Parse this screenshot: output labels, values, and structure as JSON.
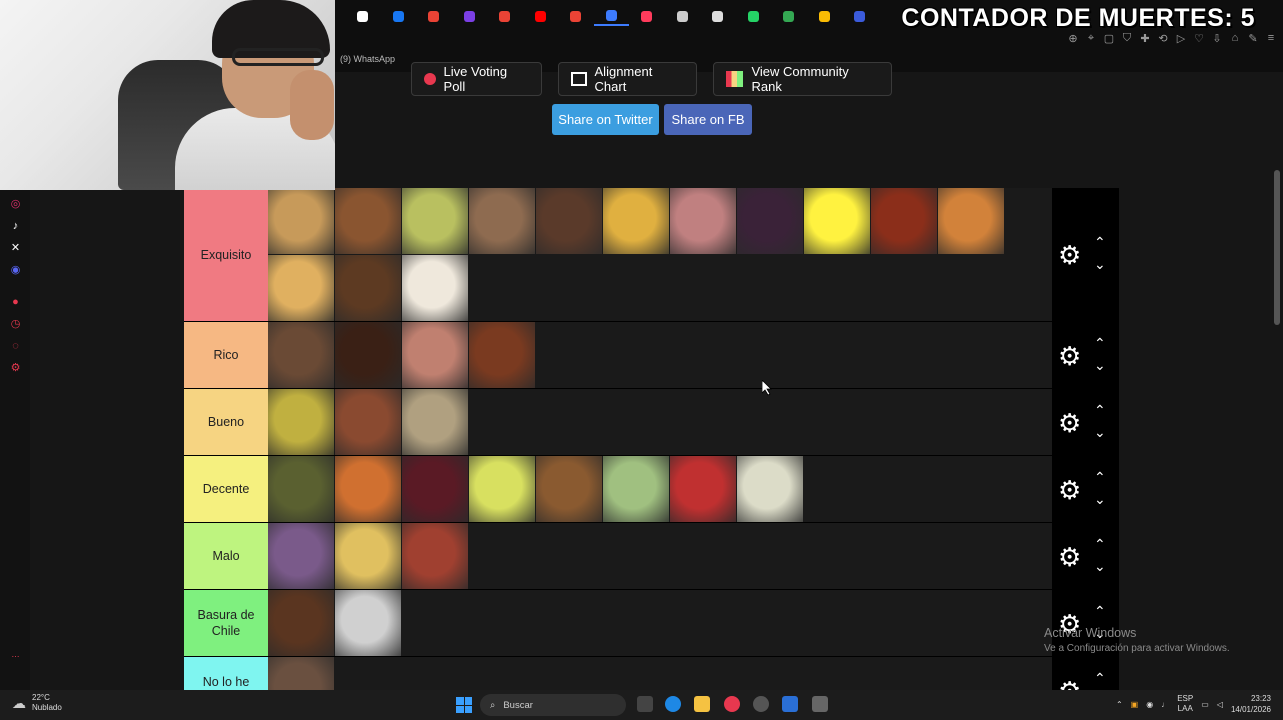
{
  "browser": {
    "tab_title": "(9) WhatsApp",
    "tab_icons": [
      "tiktok-icon",
      "facebook-icon",
      "gmail-icon",
      "purple-app-icon",
      "gmail-icon",
      "youtube-icon",
      "gmail-icon",
      "active-tab-icon",
      "wand-icon",
      "shield-icon",
      "document-icon",
      "whatsapp-icon",
      "drive-icon",
      "drive-icon",
      "shield-icon"
    ],
    "tab_colors": [
      "#ffffff",
      "#1877f2",
      "#ea4335",
      "#7b3fe4",
      "#ea4335",
      "#ff0000",
      "#ea4335",
      "#3d7bfd",
      "#ff3b5c",
      "#cccccc",
      "#dddddd",
      "#25d366",
      "#34a853",
      "#fbbc04",
      "#3b5bdb"
    ]
  },
  "overlay": {
    "counter_text": "CONTADOR DE MUERTES: 5"
  },
  "actions": {
    "live_poll": "Live Voting Poll",
    "alignment_chart": "Alignment Chart",
    "community_rank": "View Community Rank",
    "share_twitter": "Share on Twitter",
    "share_fb": "Share on FB"
  },
  "tiers": [
    {
      "label": "Exquisito",
      "color": "#f07a82",
      "items": [
        "#c79a5a",
        "#8a5530",
        "#b9c060",
        "#8e6b50",
        "#5a3a2a",
        "#e0b040",
        "#c08080",
        "#3a2238",
        "#fff240",
        "#8b2e1a",
        "#d2823a",
        "#e0b060",
        "#5d3a22",
        "#efe8dc"
      ]
    },
    {
      "label": "Rico",
      "color": "#f6b883",
      "items": [
        "#6a4a35",
        "#3a2015",
        "#c08070",
        "#7a3a20"
      ]
    },
    {
      "label": "Bueno",
      "color": "#f6d482",
      "items": [
        "#c0b040",
        "#8a4a30",
        "#b0a080"
      ]
    },
    {
      "label": "Decente",
      "color": "#f5f07f",
      "items": [
        "#5a6030",
        "#d07030",
        "#5a1a25",
        "#d8e060",
        "#8a5a30",
        "#a0c080",
        "#c03030",
        "#dcdcc8"
      ]
    },
    {
      "label": "Malo",
      "color": "#bef47f",
      "items": [
        "#7a5a8a",
        "#e0c060",
        "#a04030"
      ]
    },
    {
      "label": "Basura de Chile",
      "color": "#7ff07f",
      "items": [
        "#5a3520",
        "#d0d0d0"
      ]
    },
    {
      "label": "No lo he probado.",
      "color": "#7ff5f0",
      "items": [
        "#6a5040"
      ]
    }
  ],
  "controls": {
    "gear_icon": "⚙",
    "up_icon": "⌃",
    "down_icon": "⌄"
  },
  "watermark": {
    "line1": "Activar Windows",
    "line2": "Ve a Configuración para activar Windows."
  },
  "taskbar": {
    "weather_temp": "22°C",
    "weather_desc": "Nublado",
    "search_placeholder": "Buscar",
    "lang_top": "ESP",
    "lang_bottom": "LAA",
    "time": "23:23",
    "date": "14/01/2026"
  }
}
